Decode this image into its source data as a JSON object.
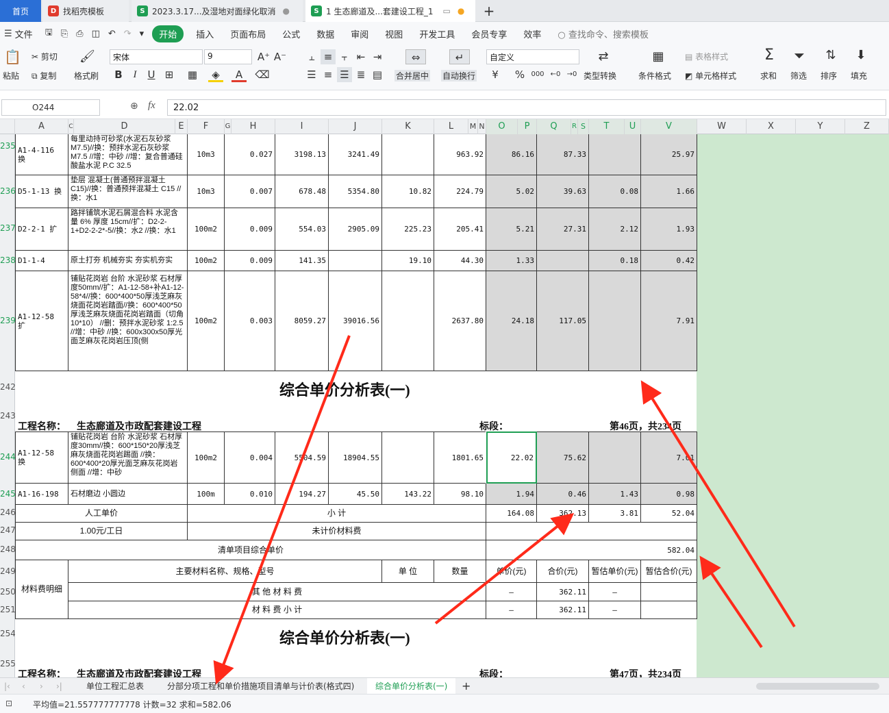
{
  "window_tabs": [
    {
      "label": "首页",
      "active": true
    },
    {
      "label": "找稻壳模板"
    },
    {
      "label": "2023.3.17...及湿地对面绿化取消"
    },
    {
      "label": "1 生态廊道及...套建设工程_1"
    }
  ],
  "new_tab": "+",
  "menu": {
    "file": "文件",
    "items": [
      "开始",
      "插入",
      "页面布局",
      "公式",
      "数据",
      "审阅",
      "视图",
      "开发工具",
      "会员专享",
      "效率"
    ],
    "search": "查找命令、搜索模板"
  },
  "ribbon": {
    "paste": "粘贴",
    "cut": "剪切",
    "copy": "复制",
    "format_painter": "格式刷",
    "font_name": "宋体",
    "font_size": "9",
    "bold": "B",
    "italic": "I",
    "underline": "U",
    "merge": "合并居中",
    "wrap": "自动换行",
    "number_format": "自定义",
    "currency": "¥",
    "percent": "%",
    "thousands": "000",
    "type_convert": "类型转换",
    "cond_format": "条件格式",
    "table_style": "表格样式",
    "cell_style": "单元格样式",
    "sum": "求和",
    "filter": "筛选",
    "sort": "排序",
    "fill": "填充"
  },
  "formula_bar": {
    "cell_ref": "O244",
    "fx": "fx",
    "value": "22.02"
  },
  "columns": [
    "A",
    "C",
    "D",
    "E",
    "F",
    "G",
    "H",
    "I",
    "J",
    "K",
    "L",
    "M",
    "N",
    "O",
    "P",
    "Q",
    "R",
    "S",
    "T",
    "U",
    "V",
    "W",
    "X",
    "Y",
    "Z"
  ],
  "rows_top": [
    {
      "num": "235",
      "a": "A1-4-116 换",
      "d": "每里动持可砂浆(水泥石灰砂浆M7.5)//换：预拌水泥石灰砂浆M7.5 //增：中砂 //增：复合普通硅酸盐水泥 P.C 32.5",
      "f": "10m3",
      "h": "0.027",
      "i": "3198.13",
      "j": "3241.49",
      "k": "",
      "l": "963.92",
      "o": "86.16",
      "p": "87.33",
      "t": "",
      "v": "25.97"
    },
    {
      "num": "236",
      "a": "D5-1-13 换",
      "d": "垫层 混凝土(普通预拌混凝土C15)//换：普通预拌混凝土 C15 //换：水1",
      "f": "10m3",
      "h": "0.007",
      "i": "678.48",
      "j": "5354.80",
      "k": "10.82",
      "l": "224.79",
      "o": "5.02",
      "p": "39.63",
      "t": "0.08",
      "v": "1.66"
    },
    {
      "num": "237",
      "a": "D2-2-1 扩",
      "d": "路拌铺筑水泥石屑混合料 水泥含量 6% 厚度 15cm//扩：D2-2-1+D2-2-2*-5//换：水2 //换：水1",
      "f": "100m2",
      "h": "0.009",
      "i": "554.03",
      "j": "2905.09",
      "k": "225.23",
      "l": "205.41",
      "o": "5.21",
      "p": "27.31",
      "t": "2.12",
      "v": "1.93"
    },
    {
      "num": "238",
      "a": "D1-1-4",
      "d": "原土打夯 机械夯实 夯实机夯实",
      "f": "100m2",
      "h": "0.009",
      "i": "141.35",
      "j": "",
      "k": "19.10",
      "l": "44.30",
      "o": "1.33",
      "p": "",
      "t": "0.18",
      "v": "0.42"
    },
    {
      "num": "239",
      "a": "A1-12-58 扩",
      "d": "铺贴花岗岩 台阶 水泥砂浆 石材厚度50mm//扩：A1-12-58+补A1-12-58*4//换：600*400*50厚浅芝麻灰烧面花岗岩踏面//换：600*400*50厚浅芝麻灰烧面花岗岩踏面（切角10*10） //删：预拌水泥砂浆 1:2.5 //增：中砂 //换：600x300x50厚光面芝麻灰花岗岩压顶(侧",
      "f": "100m2",
      "h": "0.003",
      "i": "8059.27",
      "j": "39016.56",
      "k": "",
      "l": "2637.80",
      "o": "24.18",
      "p": "117.05",
      "t": "",
      "v": "7.91"
    }
  ],
  "title1": "综合单价分析表(一)",
  "project_label": "工程名称：",
  "project_name": "生态廊道及市政配套建设工程",
  "section_label": "标段：",
  "page1": "第46页，共234页",
  "rows_mid": [
    {
      "num": "244",
      "a": "A1-12-58 换",
      "d": "铺贴花岗岩 台阶 水泥砂浆 石材厚度30mm//换：600*150*20厚浅芝麻灰烧面花岗岩踢面 //换：600*400*20厚光面芝麻灰花岗岩侧面 //增：中砂",
      "f": "100m2",
      "h": "0.004",
      "i": "5504.59",
      "j": "18904.55",
      "k": "",
      "l": "1801.65",
      "o": "22.02",
      "p": "75.62",
      "t": "",
      "v": "7.01"
    },
    {
      "num": "245",
      "a": "A1-16-198",
      "d": "石材磨边 小圆边",
      "f": "100m",
      "h": "0.010",
      "i": "194.27",
      "j": "45.50",
      "k": "143.22",
      "l": "98.10",
      "o": "1.94",
      "p": "0.46",
      "t": "1.43",
      "v": "0.98"
    }
  ],
  "row246": {
    "num": "246",
    "label": "人工单价",
    "subtotal": "小  计",
    "o": "164.08",
    "p": "362.13",
    "t": "3.81",
    "v": "52.04"
  },
  "row247": {
    "num": "247",
    "rate": "1.00元/工日",
    "unpriced": "未计价材料费"
  },
  "row248": {
    "num": "248",
    "label": "清单项目综合单价",
    "v": "582.04"
  },
  "row249": {
    "num": "249",
    "mat_detail": "材料费明细",
    "name": "主要材料名称、规格、型号",
    "unit": "单  位",
    "qty": "数量",
    "unit_price": "单价(元)",
    "total": "合价(元)",
    "est_unit": "暂估单价(元)",
    "est_total": "暂估合价(元)"
  },
  "row250": {
    "num": "250",
    "name": "其 他 材 料 费",
    "o": "—",
    "p": "362.11",
    "t": "—"
  },
  "row251": {
    "num": "251",
    "name": "材 料 费 小 计",
    "o": "—",
    "p": "362.11",
    "t": "—"
  },
  "row254": {
    "num": "254"
  },
  "row255": {
    "num": "255"
  },
  "page2": "第47页，共234页",
  "sheet_tabs": [
    "单位工程汇总表",
    "分部分项工程和单价措施项目清单与计价表(格式四)",
    "综合单价分析表(一)"
  ],
  "status": "平均值=21.557777777778  计数=32  求和=582.06",
  "colors": {
    "accent": "#1e9e53",
    "selection": "#1e9e53",
    "gray": "#d9d9d9",
    "green": "#cde8cf",
    "arrow": "#ff2a1a"
  }
}
